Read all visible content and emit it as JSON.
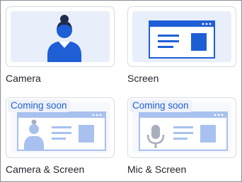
{
  "options": [
    {
      "label": "Camera",
      "icon": "webcam-person-icon",
      "badge": ""
    },
    {
      "label": "Screen",
      "icon": "screen-window-icon",
      "badge": ""
    },
    {
      "label": "Camera & Screen",
      "icon": "camera-and-screen-icon",
      "badge": "Coming soon"
    },
    {
      "label": "Mic & Screen",
      "icon": "mic-and-screen-icon",
      "badge": "Coming soon"
    }
  ],
  "colors": {
    "accent": "#1e5fd6",
    "thumb_bg": "#e8eefa",
    "card_border": "#d6dbe3"
  }
}
